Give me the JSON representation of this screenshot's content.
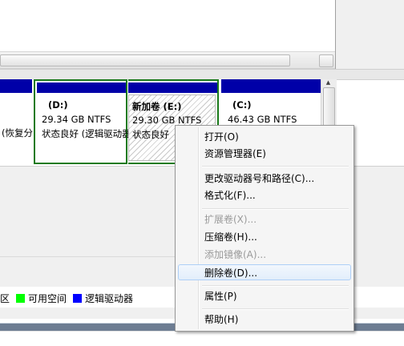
{
  "disk_map": {
    "partition_left": {
      "text_line2": "(恢复分"
    },
    "partition_d": {
      "label": "(D:)",
      "size": "29.34 GB NTFS",
      "status": "状态良好 (逻辑驱动器)"
    },
    "partition_e": {
      "label": "新加卷  (E:)",
      "size": "29.30 GB NTFS",
      "status": "状态良好"
    },
    "partition_c": {
      "label": "(C:)",
      "size": "46.43 GB NTFS",
      "status": ""
    }
  },
  "legend": {
    "prefix": "区",
    "items": [
      {
        "label": "可用空间",
        "color": "#00ff00"
      },
      {
        "label": "逻辑驱动器",
        "color": "#0000ff"
      }
    ]
  },
  "context_menu": {
    "items": [
      {
        "label": "打开(O)",
        "enabled": true
      },
      {
        "label": "资源管理器(E)",
        "enabled": true
      },
      {
        "label": "更改驱动器号和路径(C)...",
        "enabled": true
      },
      {
        "label": "格式化(F)...",
        "enabled": true
      },
      {
        "label": "扩展卷(X)...",
        "enabled": false
      },
      {
        "label": "压缩卷(H)...",
        "enabled": true
      },
      {
        "label": "添加镜像(A)...",
        "enabled": false
      },
      {
        "label": "删除卷(D)...",
        "enabled": true,
        "highlighted": true
      },
      {
        "label": "属性(P)",
        "enabled": true
      },
      {
        "label": "帮助(H)",
        "enabled": true
      }
    ]
  },
  "colors": {
    "partition_bar": "#0000a8",
    "selection_border": "#1a7a1a"
  }
}
